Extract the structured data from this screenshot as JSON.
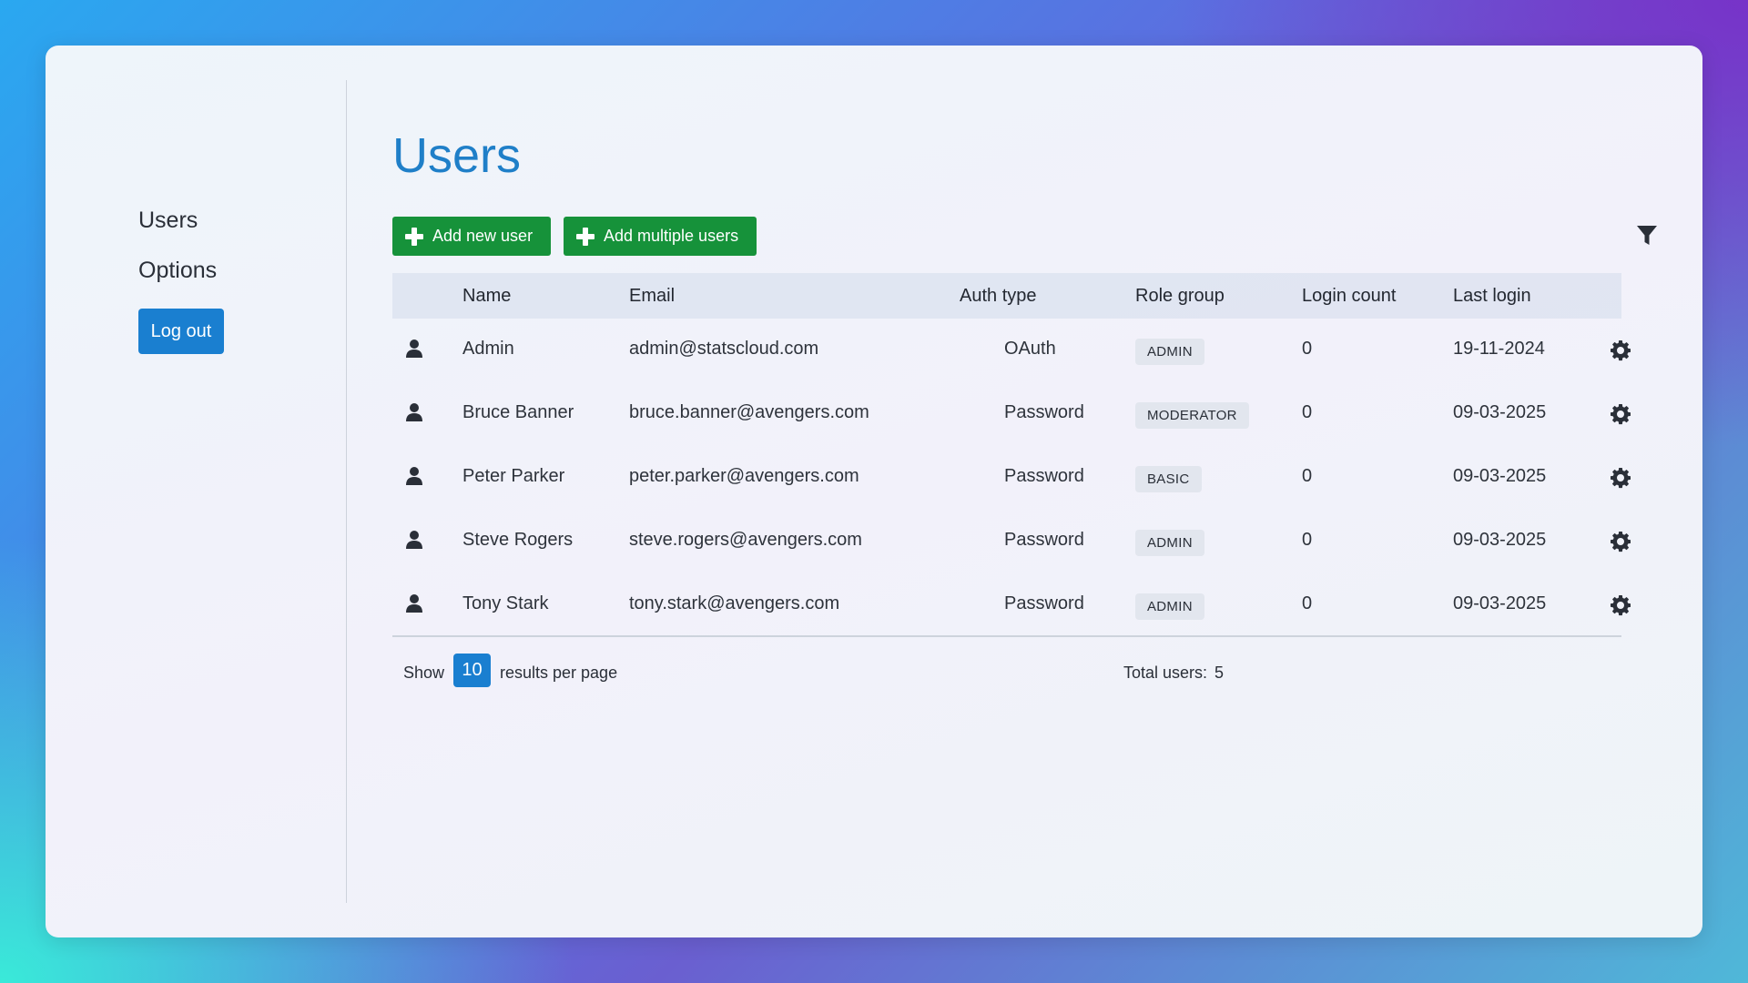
{
  "sidebar": {
    "items": [
      {
        "label": "Users"
      },
      {
        "label": "Options"
      }
    ],
    "logout_label": "Log out"
  },
  "main": {
    "title": "Users",
    "add_user_label": "Add new user",
    "add_multiple_label": "Add multiple users",
    "filter_icon": "filter-icon"
  },
  "table": {
    "columns": [
      "Name",
      "Email",
      "Auth type",
      "Role group",
      "Login count",
      "Last login"
    ],
    "rows": [
      {
        "name": "Admin",
        "email": "admin@statscloud.com",
        "auth": "OAuth",
        "role": "ADMIN",
        "count": "0",
        "last": "19-11-2024"
      },
      {
        "name": "Bruce Banner",
        "email": "bruce.banner@avengers.com",
        "auth": "Password",
        "role": "MODERATOR",
        "count": "0",
        "last": "09-03-2025"
      },
      {
        "name": "Peter Parker",
        "email": "peter.parker@avengers.com",
        "auth": "Password",
        "role": "BASIC",
        "count": "0",
        "last": "09-03-2025"
      },
      {
        "name": "Steve Rogers",
        "email": "steve.rogers@avengers.com",
        "auth": "Password",
        "role": "ADMIN",
        "count": "0",
        "last": "09-03-2025"
      },
      {
        "name": "Tony Stark",
        "email": "tony.stark@avengers.com",
        "auth": "Password",
        "role": "ADMIN",
        "count": "0",
        "last": "09-03-2025"
      }
    ]
  },
  "footer": {
    "show_label": "Show",
    "per_page": "10",
    "results_label": "results per page",
    "total_label": "Total users:",
    "total_value": "5"
  },
  "colors": {
    "accent": "#1a7fd0",
    "success": "#16923a",
    "title": "#1f7fc8"
  }
}
